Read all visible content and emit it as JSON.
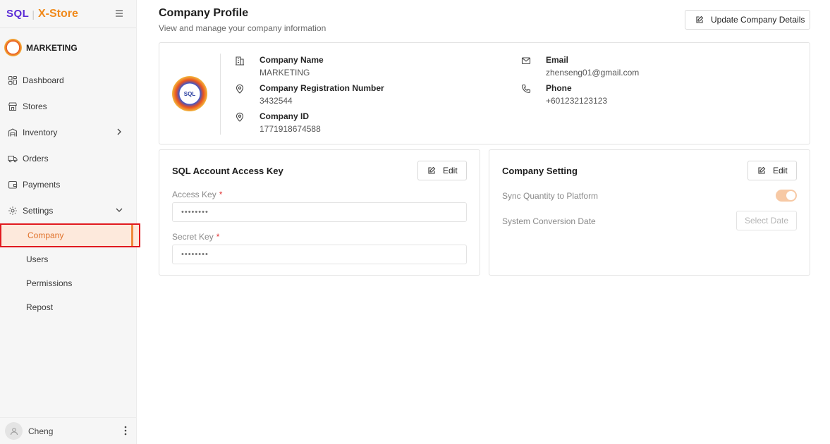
{
  "brand": {
    "part1": "SQL",
    "separator": "|",
    "part2": "X-Store"
  },
  "company": {
    "name": "MARKETING"
  },
  "sidebar": {
    "items": [
      {
        "label": "Dashboard"
      },
      {
        "label": "Stores"
      },
      {
        "label": "Inventory"
      },
      {
        "label": "Orders"
      },
      {
        "label": "Payments"
      },
      {
        "label": "Settings"
      }
    ],
    "sub_items": [
      {
        "label": "Company"
      },
      {
        "label": "Users"
      },
      {
        "label": "Permissions"
      },
      {
        "label": "Repost"
      }
    ]
  },
  "user": {
    "name": "Cheng"
  },
  "header": {
    "title": "Company Profile",
    "subtitle": "View and manage your company information",
    "update_button": "Update Company Details"
  },
  "profile": {
    "logo_text": "SQL",
    "company_name_label": "Company Name",
    "company_name_value": "MARKETING",
    "reg_label": "Company Registration Number",
    "reg_value": "3432544",
    "id_label": "Company ID",
    "id_value": "1771918674588",
    "email_label": "Email",
    "email_value": "zhenseng01@gmail.com",
    "phone_label": "Phone",
    "phone_value": "+601232123123"
  },
  "access_key_card": {
    "title": "SQL Account Access Key",
    "edit_label": "Edit",
    "access_key_label": "Access Key",
    "access_key_value": "••••••••",
    "secret_key_label": "Secret Key",
    "secret_key_value": "••••••••",
    "required_mark": "*"
  },
  "setting_card": {
    "title": "Company Setting",
    "edit_label": "Edit",
    "sync_label": "Sync Quantity to Platform",
    "sync_enabled": true,
    "conversion_label": "System Conversion Date",
    "date_placeholder": "Select Date"
  },
  "colors": {
    "brand_purple": "#5b2bd6",
    "brand_orange": "#f08a1c",
    "active_highlight": "#e1191f",
    "toggle_on": "#f7c9a5"
  }
}
